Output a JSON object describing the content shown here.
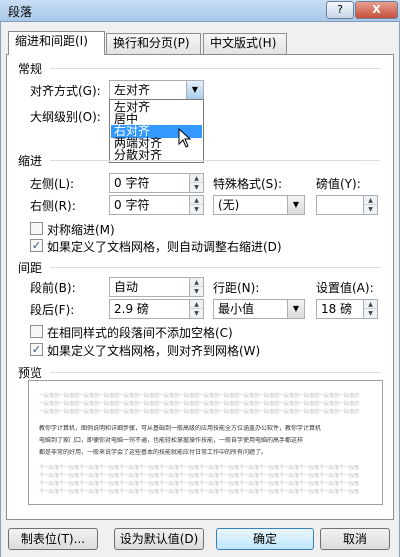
{
  "window": {
    "title": "段落",
    "help_label": "?",
    "close_label": "X"
  },
  "tabs": [
    {
      "label": "缩进和间距(I)",
      "active": true
    },
    {
      "label": "换行和分页(P)",
      "active": false
    },
    {
      "label": "中文版式(H)",
      "active": false
    }
  ],
  "general": {
    "section": "常规",
    "alignment_label": "对齐方式(G):",
    "alignment_value": "左对齐",
    "outline_label": "大纲级别(O):",
    "alignment_options": [
      "左对齐",
      "居中",
      "右对齐",
      "两端对齐",
      "分散对齐"
    ],
    "highlighted_option": "右对齐"
  },
  "indent": {
    "section": "缩进",
    "left_label": "左侧(L):",
    "left_value": "0 字符",
    "right_label": "右侧(R):",
    "right_value": "0 字符",
    "special_label": "特殊格式(S):",
    "special_value": "(无)",
    "by_label": "磅值(Y):",
    "by_value": "",
    "mirror_label": "对称缩进(M)",
    "mirror_checked": false,
    "grid_indent_label": "如果定义了文档网格，则自动调整右缩进(D)",
    "grid_indent_checked": true
  },
  "spacing": {
    "section": "间距",
    "before_label": "段前(B):",
    "before_value": "自动",
    "after_label": "段后(F):",
    "after_value": "2.9 磅",
    "line_label": "行距(N):",
    "line_value": "最小值",
    "at_label": "设置值(A):",
    "at_value": "18 磅",
    "no_space_label": "在相同样式的段落间不添加空格(C)",
    "no_space_checked": false,
    "snap_grid_label": "如果定义了文档网格，则对齐到网格(W)",
    "snap_grid_checked": true
  },
  "preview": {
    "section": "预览",
    "gray_line": "一段落前一段落前一段落前一段落前一段落前一段落前一段落前一段落前一段落前一段落前一段落前一段落前一段落前一段落前一段落前一段落前",
    "gray_line_after": "下一段落下一段落下一段落下一段落下一段落下一段落下一段落下一段落下一段落下一段落下一段落下一段落下一段落下一段落下一段落下一段落",
    "body_lines": [
      "教你学计算机，图例说明和详细步骤，可从基础到一般高级的应用技能全方位涵盖办公软件，教你学计算机",
      "电脑到了家门口，即便你对电脑一窍不通，也能轻松掌握操作技能，一般自学使用电脑的高手都这样",
      "都是非常的好用，一般来说学会了这些基本的技能就能应付日常工作中的所有问题了。"
    ]
  },
  "buttons": {
    "tabs": "制表位(T)...",
    "default": "设为默认值(D)",
    "ok": "确定",
    "cancel": "取消"
  }
}
